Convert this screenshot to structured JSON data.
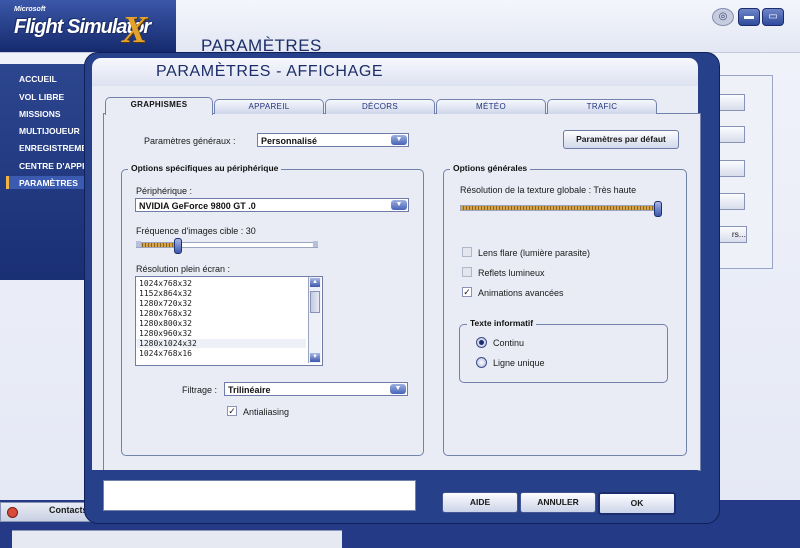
{
  "app": {
    "logo_microsoft": "Microsoft",
    "logo_title": "Flight Simulator",
    "logo_x": "X",
    "background_title": "PARAMÈTRES",
    "window_buttons": {
      "sound": "◎",
      "minimize": "▬",
      "maximize": "▭"
    }
  },
  "nav": {
    "items": [
      "ACCUEIL",
      "VOL LIBRE",
      "MISSIONS",
      "MULTIJOUEUR",
      "ENREGISTREMENT",
      "CENTRE D'APPR",
      "PARAMÈTRES"
    ],
    "selected": "PARAMÈTRES"
  },
  "right_panel": {
    "partial_button_label": "rs..."
  },
  "contacts": {
    "label": "Contacts"
  },
  "dialog": {
    "title": "PARAMÈTRES - AFFICHAGE",
    "tabs": [
      "GRAPHISMES",
      "APPAREIL",
      "DÉCORS",
      "MÉTÉO",
      "TRAFIC"
    ],
    "active_tab": "GRAPHISMES",
    "general_params_label": "Paramètres généraux :",
    "general_params_value": "Personnalisé",
    "default_button": "Paramètres par défaut",
    "device_group": {
      "title": "Options spécifiques au périphérique",
      "device_label": "Périphérique :",
      "device_value": "NVIDIA GeForce 9800 GT  .0",
      "framerate_label": "Fréquence d'images cible : 30",
      "framerate_level": 0.22,
      "resolution_label": "Résolution plein écran :",
      "resolutions": [
        "1024x768x32",
        "1152x864x32",
        "1280x720x32",
        "1280x768x32",
        "1280x800x32",
        "1280x960x32",
        "1280x1024x32",
        "1024x768x16"
      ],
      "selected_resolution": "1280x1024x32",
      "filter_label": "Filtrage :",
      "filter_value": "Trilinéaire",
      "antialiasing_label": "Antialiasing",
      "antialiasing_checked": true
    },
    "general_group": {
      "title": "Options générales",
      "texture_label": "Résolution de la texture globale : Très haute",
      "texture_level": 1.0,
      "checkboxes": [
        {
          "label": "Lens flare (lumière parasite)",
          "checked": false,
          "enabled": false
        },
        {
          "label": "Reflets lumineux",
          "checked": false,
          "enabled": false
        },
        {
          "label": "Animations avancées",
          "checked": true,
          "enabled": true
        }
      ],
      "info_group": {
        "title": "Texte informatif",
        "options": [
          "Continu",
          "Ligne unique"
        ],
        "selected": "Continu"
      }
    },
    "buttons": {
      "help": "AIDE",
      "cancel": "ANNULER",
      "ok": "OK"
    }
  }
}
